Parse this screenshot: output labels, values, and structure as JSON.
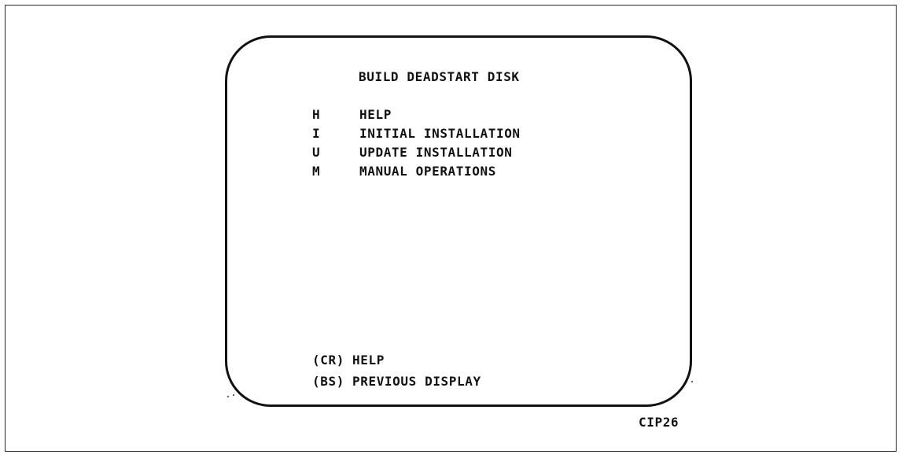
{
  "screen": {
    "title": "BUILD DEADSTART DISK",
    "menu": [
      {
        "key": "H",
        "label": "HELP"
      },
      {
        "key": "I",
        "label": "INITIAL INSTALLATION"
      },
      {
        "key": "U",
        "label": "UPDATE INSTALLATION"
      },
      {
        "key": "M",
        "label": "MANUAL OPERATIONS"
      }
    ],
    "footer": [
      {
        "key": "(CR)",
        "label": "HELP"
      },
      {
        "key": "(BS)",
        "label": "PREVIOUS DISPLAY"
      }
    ]
  },
  "figure_id": "CIP26"
}
